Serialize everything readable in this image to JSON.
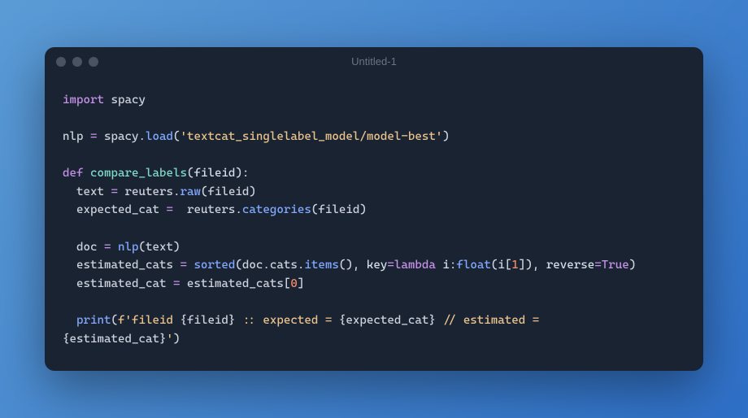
{
  "window": {
    "title": "Untitled-1"
  },
  "code": {
    "t1": "import",
    "t2": " spacy",
    "t3": "nlp ",
    "t4": "=",
    "t5": " spacy",
    "t6": ".",
    "t7": "load",
    "t8": "(",
    "t9": "'textcat_singlelabel_model/model-best'",
    "t10": ")",
    "t11": "def",
    "t12": " ",
    "t13": "compare_labels",
    "t14": "(",
    "t15": "fileid",
    "t16": "):",
    "t17": "  text ",
    "t18": "=",
    "t19": " reuters",
    "t20": ".",
    "t21": "raw",
    "t22": "(fileid)",
    "t23": "  expected_cat ",
    "t24": "=",
    "t25": "  reuters",
    "t26": ".",
    "t27": "categories",
    "t28": "(fileid)",
    "t29": "  doc ",
    "t30": "=",
    "t31": " ",
    "t32": "nlp",
    "t33": "(text)",
    "t34": "  estimated_cats ",
    "t35": "=",
    "t36": " ",
    "t37": "sorted",
    "t38": "(doc",
    "t39": ".",
    "t40": "cats",
    "t41": ".",
    "t42": "items",
    "t43": "(), ",
    "t44": "key",
    "t45": "=",
    "t46": "lambda",
    "t47": " ",
    "t48": "i",
    "t49": ":",
    "t50": "float",
    "t51": "(i[",
    "t52": "1",
    "t53": "]), ",
    "t54": "reverse",
    "t55": "=",
    "t56": "True",
    "t57": ")",
    "t58": "  estimated_cat ",
    "t59": "=",
    "t60": " estimated_cats[",
    "t61": "0",
    "t62": "]",
    "t63": "  ",
    "t64": "print",
    "t65": "(",
    "t66": "f'fileid ",
    "t67": "{fileid}",
    "t68": " :: expected = ",
    "t69": "{expected_cat}",
    "t70": " // estimated = ",
    "t71": "{estimated_cat}",
    "t72": "'",
    "t73": ")"
  }
}
